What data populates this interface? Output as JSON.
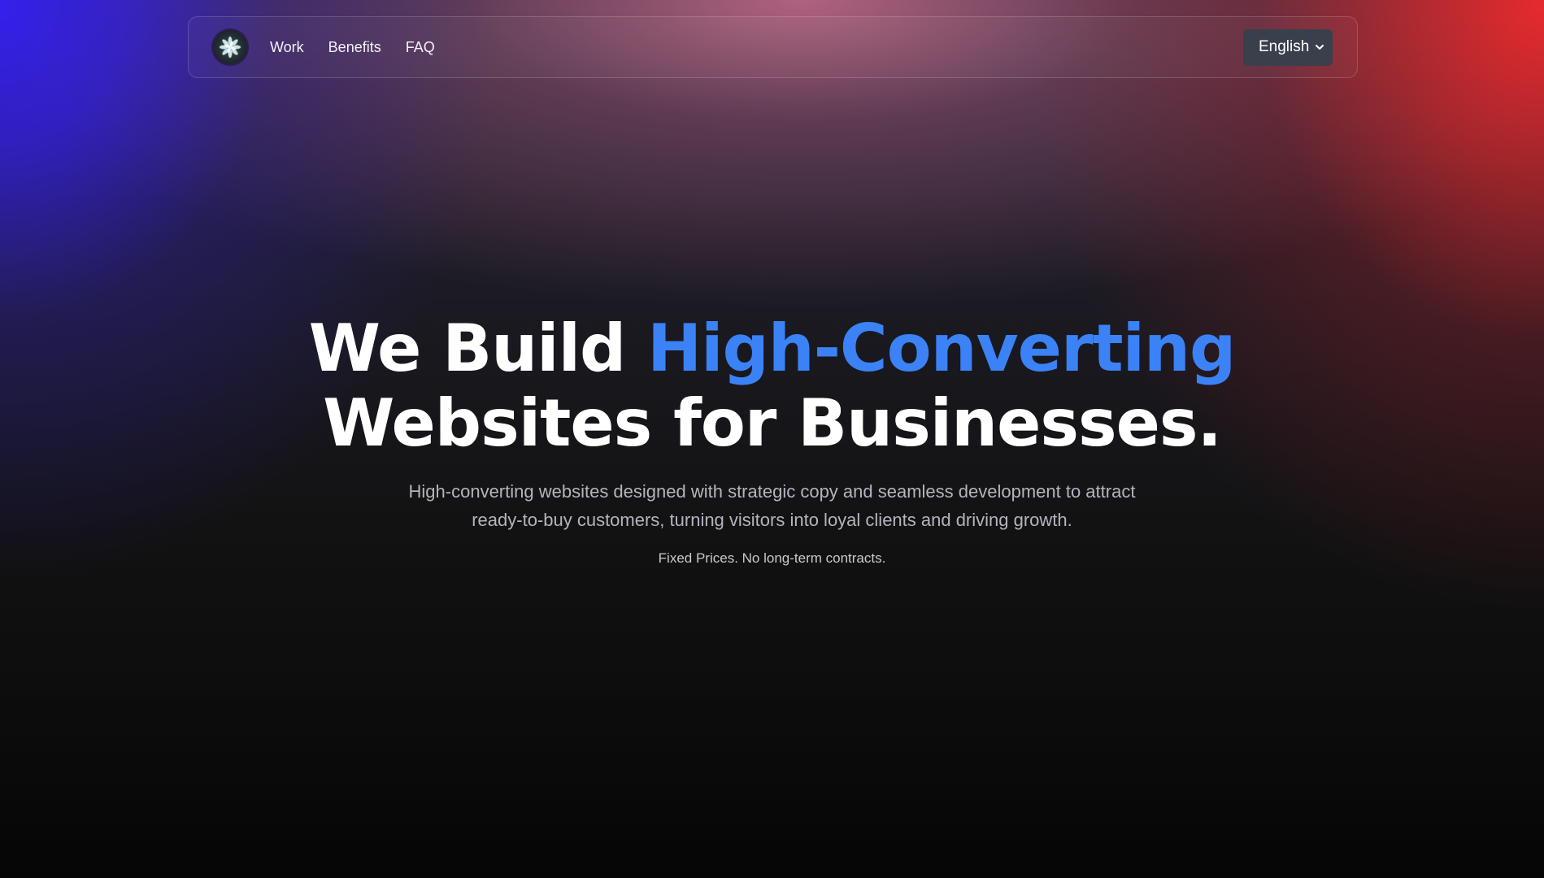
{
  "nav": {
    "logo_icon": "flower-logo-icon",
    "links": [
      "Work",
      "Benefits",
      "FAQ"
    ],
    "language": "English",
    "language_icon": "chevron-down-icon"
  },
  "hero": {
    "headline_part1": "We Build ",
    "headline_accent": "High-Converting",
    "headline_part2": "Websites for Businesses.",
    "subheadline_line1": "High-converting websites designed with strategic copy and seamless development to attract",
    "subheadline_line2": "ready-to-buy customers, turning visitors into loyal clients and driving growth.",
    "note": "Fixed Prices. No long-term contracts."
  },
  "colors": {
    "accent": "#3b82f6",
    "gradient_left": "#3420ec",
    "gradient_right": "#e82a2e",
    "background": "#0d0d0e"
  }
}
